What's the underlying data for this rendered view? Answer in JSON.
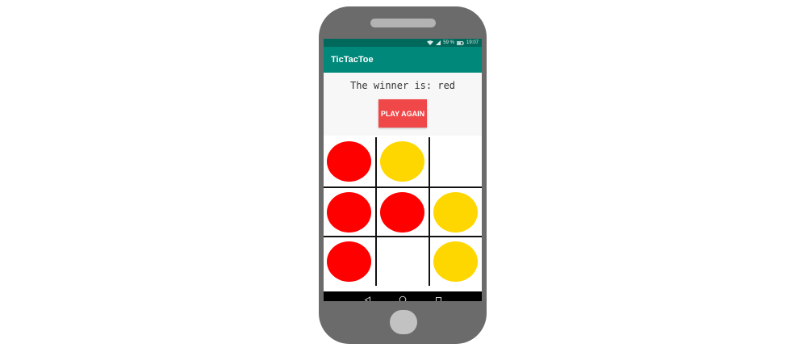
{
  "status_bar": {
    "battery": "59 %",
    "time": "19:07",
    "wifi_icon": "wifi-icon",
    "signal_icon": "signal-icon",
    "battery_icon": "battery-icon"
  },
  "app_bar": {
    "title": "TicTacToe"
  },
  "game": {
    "winner_text": "The winner is: red",
    "play_again_label": "PLAY AGAIN"
  },
  "colors": {
    "red": "#ff0000",
    "yellow": "#ffd700",
    "app_bar": "#00897b",
    "status_bar": "#00695c",
    "play_again": "#f04848"
  },
  "board": [
    [
      "red",
      "yellow",
      ""
    ],
    [
      "red",
      "red",
      "yellow"
    ],
    [
      "red",
      "",
      "yellow"
    ]
  ],
  "nav": {
    "back_icon": "back-triangle-icon",
    "home_icon": "home-circle-icon",
    "recents_icon": "recents-square-icon"
  }
}
